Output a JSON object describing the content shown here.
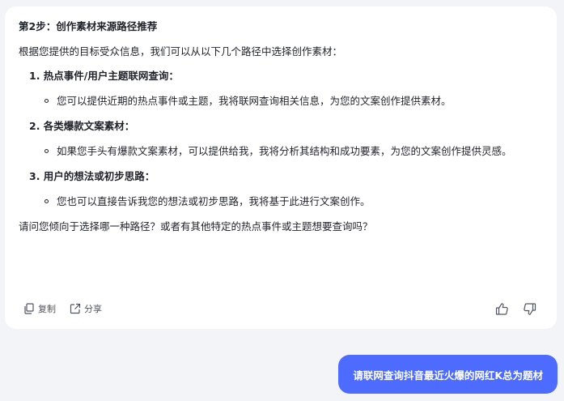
{
  "assistant_message": {
    "heading": "第2步：创作素材来源路径推荐",
    "intro": "根据您提供的目标受众信息，我们可以从以下几个路径中选择创作素材：",
    "items": [
      {
        "title": "1. 热点事件/用户主题联网查询：",
        "detail": "您可以提供近期的热点事件或主题，我将联网查询相关信息，为您的文案创作提供素材。"
      },
      {
        "title": "2. 各类爆款文案素材：",
        "detail": "如果您手头有爆款文案素材，可以提供给我，我将分析其结构和成功要素，为您的文案创作提供灵感。"
      },
      {
        "title": "3. 用户的想法或初步思路：",
        "detail": "您也可以直接告诉我您的想法或初步思路，我将基于此进行文案创作。"
      }
    ],
    "question": "请问您倾向于选择哪一种路径？或者有其他特定的热点事件或主题想要查询吗？",
    "actions": {
      "copy_label": "复制",
      "share_label": "分享"
    }
  },
  "user_message": {
    "text": "请联网查询抖音最近火爆的网红K总为题材"
  },
  "colors": {
    "page_background": "#f3f4f8",
    "assistant_bubble": "#ffffff",
    "user_bubble": "#4d6bfe",
    "text": "#1f2329",
    "icon": "#4e5563"
  },
  "icons": [
    "copy-icon",
    "share-icon",
    "thumbs-up-icon",
    "thumbs-down-icon"
  ]
}
